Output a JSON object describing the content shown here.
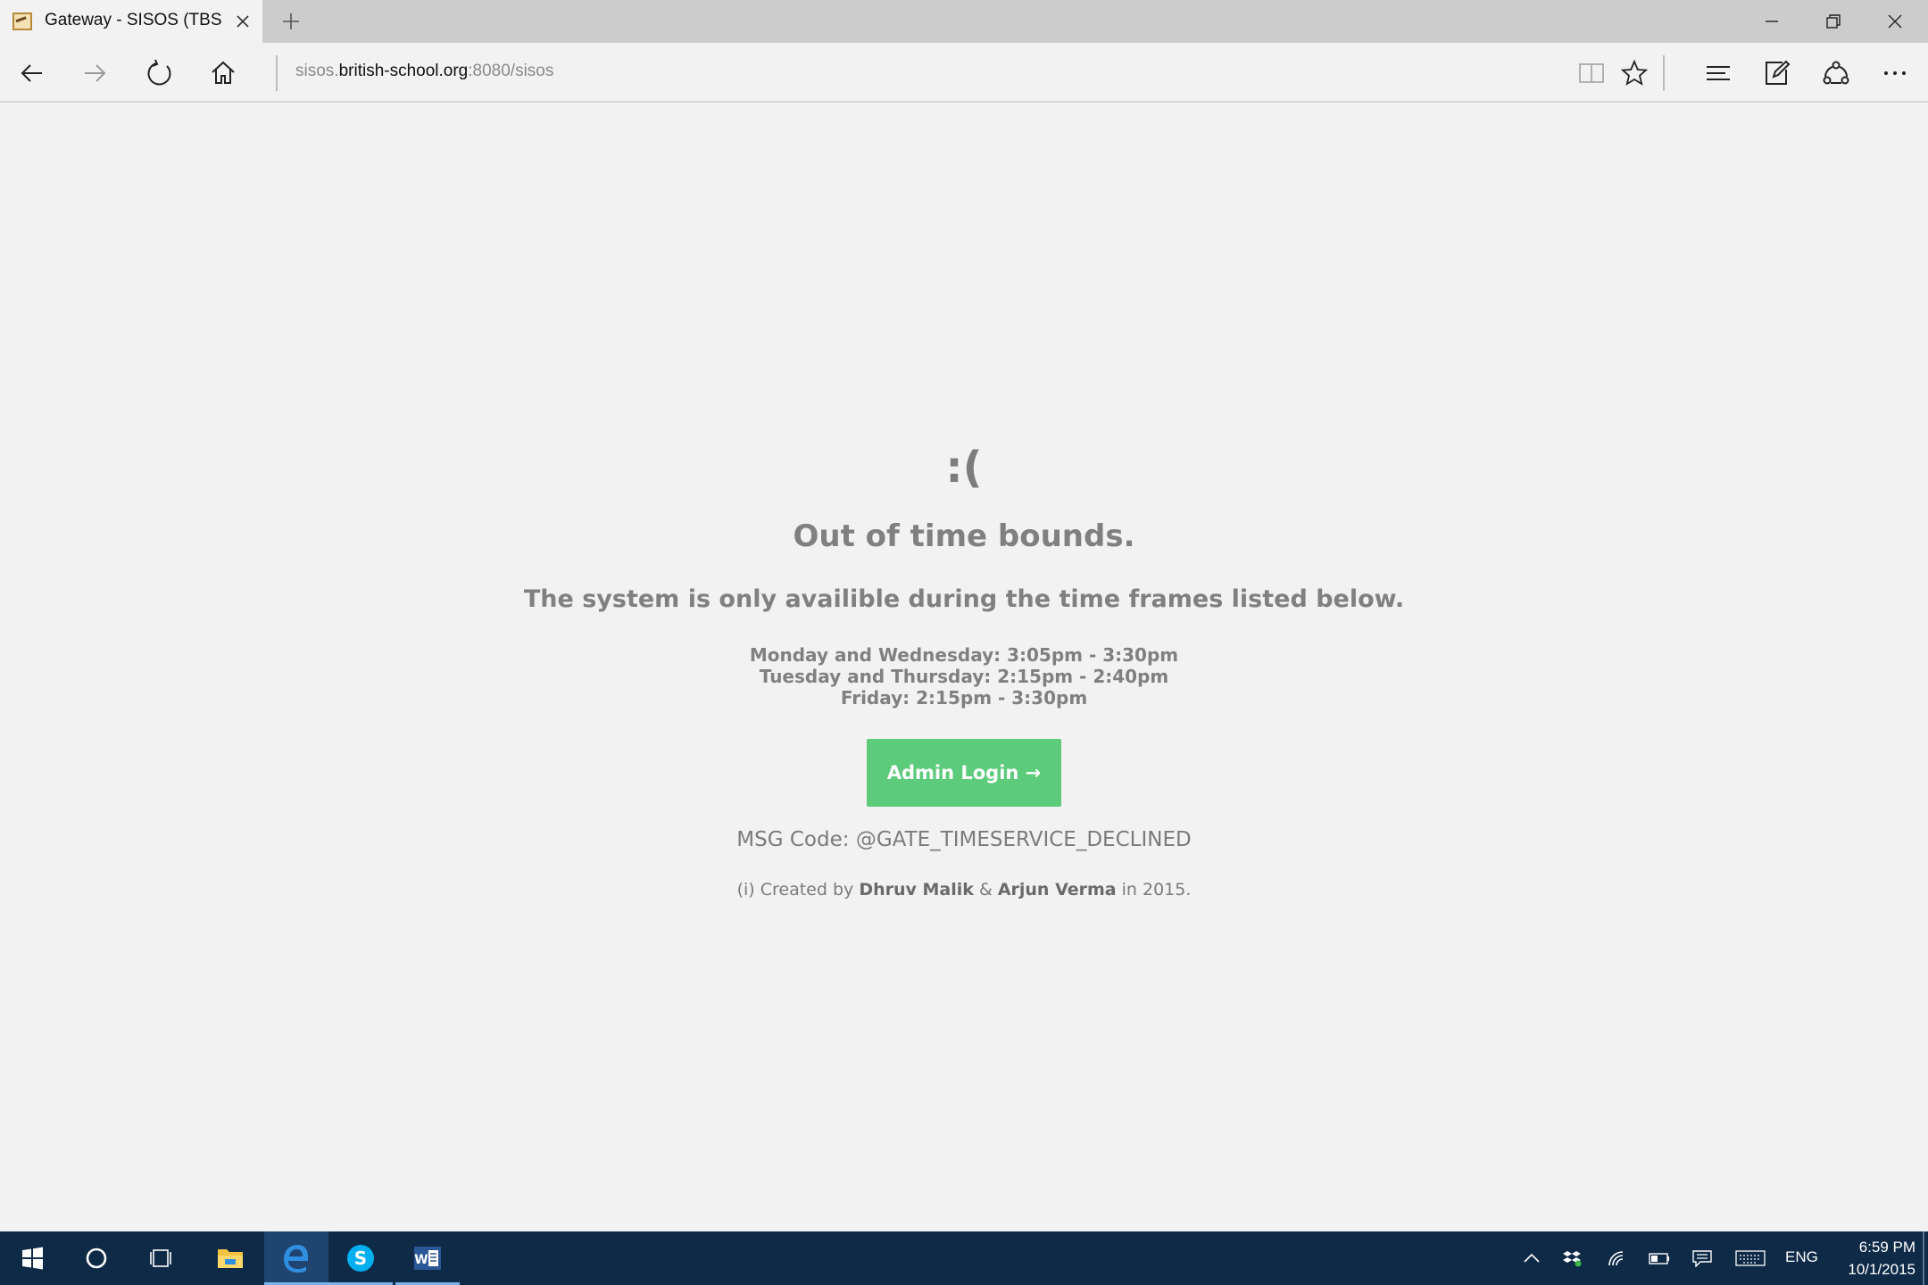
{
  "browser": {
    "tab": {
      "title": "Gateway - SISOS (TBS Ir"
    },
    "address": {
      "url_prefix": "sisos.",
      "url_host": "british-school.org",
      "url_suffix": ":8080/sisos"
    }
  },
  "page": {
    "sad_face": ":(",
    "heading": "Out of time bounds.",
    "subheading": "The system is only availible during the time frames listed below.",
    "schedule": [
      "Monday and Wednesday: 3:05pm - 3:30pm",
      "Tuesday and Thursday: 2:15pm - 2:40pm",
      "Friday: 2:15pm - 3:30pm"
    ],
    "admin_button": "Admin Login →",
    "msg_code": "MSG Code: @GATE_TIMESERVICE_DECLINED",
    "credit": {
      "prefix": "(i) Created by ",
      "author1": "Dhruv Malik",
      "and": " & ",
      "author2": "Arjun Verma",
      "suffix": " in 2015."
    },
    "colors": {
      "button": "#5ccb7b",
      "text": "#7b7b7b"
    }
  },
  "taskbar": {
    "apps": [
      "start-icon",
      "cortana-icon",
      "task-view-icon",
      "file-explorer-icon",
      "edge-icon",
      "skype-icon",
      "word-icon"
    ],
    "language": "ENG",
    "time": "6:59 PM",
    "date": "10/1/2015"
  }
}
